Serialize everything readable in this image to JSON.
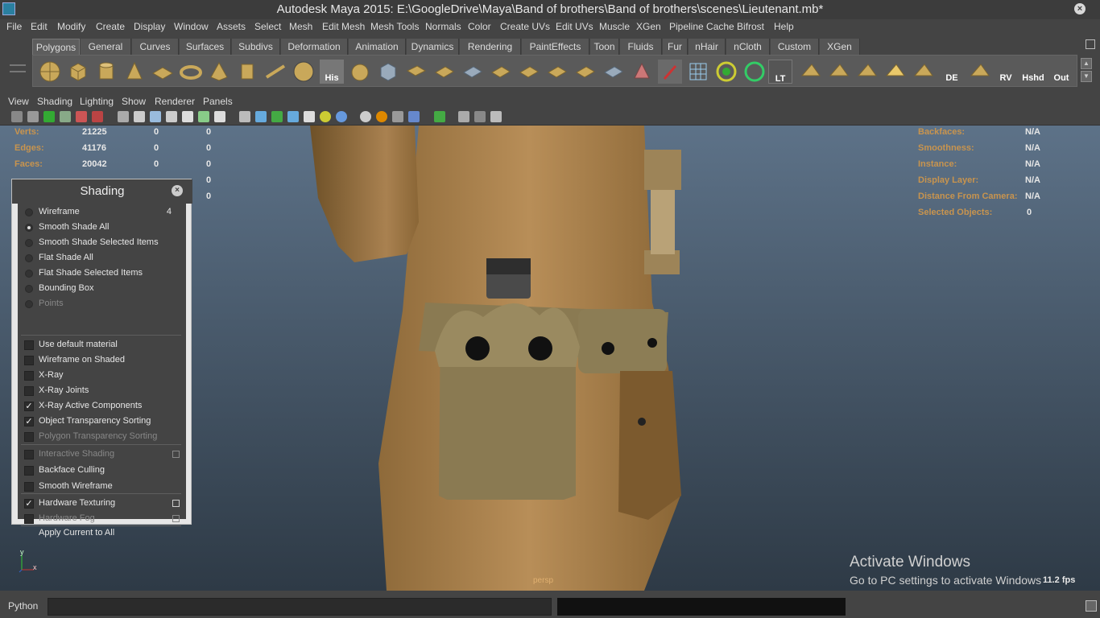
{
  "window": {
    "title": "Autodesk Maya 2015: E:\\GoogleDrive\\Maya\\Band of brothers\\Band of brothers\\scenes\\Lieutenant.mb*",
    "close_glyph": "×",
    "logo_icon": "maya-logo-icon"
  },
  "menubar": [
    "File",
    "Edit",
    "Modify",
    "Create",
    "Display",
    "Window",
    "Assets",
    "Select",
    "Mesh",
    "Edit Mesh",
    "Mesh Tools",
    "Normals",
    "Color",
    "Create UVs",
    "Edit UVs",
    "Muscle",
    "XGen",
    "Pipeline Cache",
    "Bifrost",
    "Help"
  ],
  "shelf": {
    "tabs": [
      "Polygons",
      "General",
      "Curves",
      "Surfaces",
      "Subdivs",
      "Deformation",
      "Animation",
      "Dynamics",
      "Rendering",
      "PaintEffects",
      "Toon",
      "Fluids",
      "Fur",
      "nHair",
      "nCloth",
      "Custom",
      "XGen"
    ],
    "active_tab": "Polygons",
    "icon_labels": {
      "his": "His",
      "lt": "LT",
      "de": "DE",
      "rv": "RV",
      "hshd": "Hshd",
      "out": "Out"
    },
    "scroll_up": "▲",
    "scroll_down": "▼"
  },
  "panel_menu": [
    "View",
    "Shading",
    "Lighting",
    "Show",
    "Renderer",
    "Panels"
  ],
  "hud_left": [
    {
      "label": "Verts:",
      "values": [
        "21225",
        "0",
        "0"
      ]
    },
    {
      "label": "Edges:",
      "values": [
        "41176",
        "0",
        "0"
      ]
    },
    {
      "label": "Faces:",
      "values": [
        "20042",
        "0",
        "0"
      ]
    },
    {
      "label": "",
      "values": [
        "",
        "",
        "0"
      ]
    },
    {
      "label": "",
      "values": [
        "",
        "",
        "0"
      ]
    }
  ],
  "hud_right": [
    {
      "label": "Backfaces:",
      "value": "N/A"
    },
    {
      "label": "Smoothness:",
      "value": "N/A"
    },
    {
      "label": "Instance:",
      "value": "N/A"
    },
    {
      "label": "Display Layer:",
      "value": "N/A"
    },
    {
      "label": "Distance From Camera:",
      "value": "N/A"
    },
    {
      "label": "Selected Objects:",
      "value": "0"
    }
  ],
  "viewport": {
    "camera": "persp",
    "fps": "11.2 fps",
    "axis_y": "y",
    "axis_x": "x"
  },
  "shading_panel": {
    "title": "Shading",
    "close_glyph": "×",
    "radio_items": [
      {
        "label": "Wireframe",
        "hotkey": "4",
        "selected": false,
        "enabled": true
      },
      {
        "label": "Smooth Shade All",
        "hotkey": "",
        "selected": true,
        "enabled": true
      },
      {
        "label": "Smooth Shade Selected Items",
        "hotkey": "",
        "selected": false,
        "enabled": true
      },
      {
        "label": "Flat Shade All",
        "hotkey": "",
        "selected": false,
        "enabled": true
      },
      {
        "label": "Flat Shade Selected Items",
        "hotkey": "",
        "selected": false,
        "enabled": true
      },
      {
        "label": "Bounding Box",
        "hotkey": "",
        "selected": false,
        "enabled": true
      },
      {
        "label": "Points",
        "hotkey": "",
        "selected": false,
        "enabled": false
      }
    ],
    "check_items_a": [
      {
        "label": "Use default material",
        "checked": false,
        "enabled": true
      },
      {
        "label": "Wireframe on Shaded",
        "checked": false,
        "enabled": true
      },
      {
        "label": "X-Ray",
        "checked": false,
        "enabled": true
      },
      {
        "label": "X-Ray Joints",
        "checked": false,
        "enabled": true
      },
      {
        "label": "X-Ray Active Components",
        "checked": true,
        "enabled": true
      },
      {
        "label": "Object Transparency Sorting",
        "checked": true,
        "enabled": true
      },
      {
        "label": "Polygon Transparency Sorting",
        "checked": false,
        "enabled": false
      }
    ],
    "check_items_b": [
      {
        "label": "Interactive Shading",
        "checked": false,
        "enabled": false,
        "option_box": true
      },
      {
        "label": "Backface Culling",
        "checked": false,
        "enabled": true,
        "option_box": false
      },
      {
        "label": "Smooth Wireframe",
        "checked": false,
        "enabled": true,
        "option_box": false
      }
    ],
    "check_items_c": [
      {
        "label": "Hardware Texturing",
        "checked": true,
        "enabled": true,
        "option_box": true
      },
      {
        "label": "Hardware Fog",
        "checked": false,
        "enabled": false,
        "option_box": true
      }
    ],
    "apply_label": "Apply Current to All",
    "check_glyph": "✓"
  },
  "command_line": {
    "language": "Python",
    "value": ""
  },
  "watermark": {
    "line1": "Activate Windows",
    "line2": "Go to PC settings to activate Windows."
  },
  "colors": {
    "hud_label": "#c8944e",
    "viewport_bg_top": "#5d7288",
    "coat": "#b08650",
    "canteen": "#8a7a52"
  }
}
